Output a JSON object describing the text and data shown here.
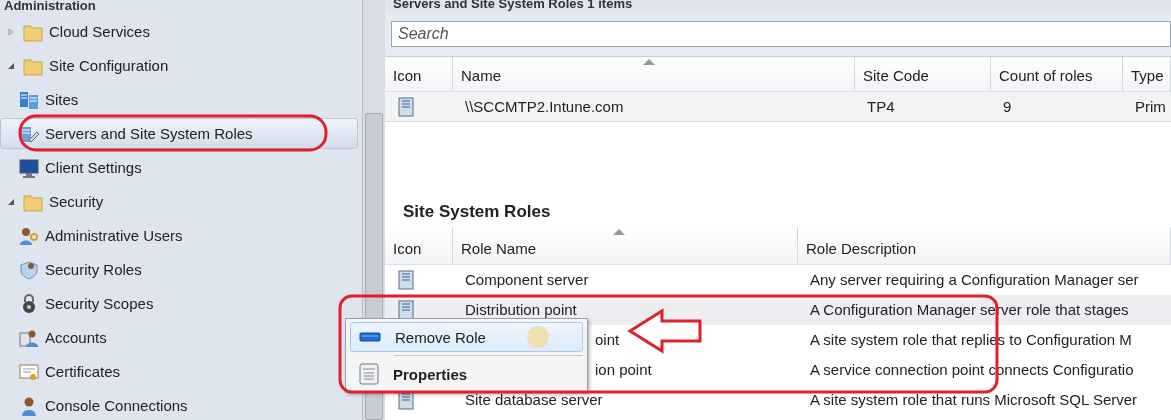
{
  "sidebar": {
    "header": "Administration",
    "items": [
      {
        "label": "Cloud Services",
        "kind": "folder",
        "expanded": false,
        "selected": false
      },
      {
        "label": "Site Configuration",
        "kind": "folder",
        "expanded": true,
        "selected": false,
        "children": [
          {
            "label": "Sites",
            "kind": "node",
            "selected": false
          },
          {
            "label": "Servers and Site System Roles",
            "kind": "node",
            "selected": true
          },
          {
            "label": "Client Settings",
            "kind": "node",
            "selected": false
          }
        ]
      },
      {
        "label": "Security",
        "kind": "folder",
        "expanded": true,
        "selected": false,
        "children": [
          {
            "label": "Administrative Users",
            "kind": "node",
            "selected": false
          },
          {
            "label": "Security Roles",
            "kind": "node",
            "selected": false
          },
          {
            "label": "Security Scopes",
            "kind": "node",
            "selected": false
          },
          {
            "label": "Accounts",
            "kind": "node",
            "selected": false
          },
          {
            "label": "Certificates",
            "kind": "node",
            "selected": false
          },
          {
            "label": "Console Connections",
            "kind": "node",
            "selected": false
          }
        ]
      }
    ]
  },
  "servers": {
    "title": "Servers and Site System Roles 1 items",
    "search": {
      "placeholder": "Search"
    },
    "columns": [
      "Icon",
      "Name",
      "Site Code",
      "Count of roles",
      "Type"
    ],
    "rows": [
      {
        "name": "\\\\SCCMTP2.Intune.com",
        "site_code": "TP4",
        "count": "9",
        "type": "Prim"
      }
    ]
  },
  "roles": {
    "title": "Site System Roles",
    "columns": [
      "Icon",
      "Role Name",
      "Role Description"
    ],
    "rows": [
      {
        "name": "Component server",
        "description": "Any server requiring a Configuration Manager ser",
        "selected": false
      },
      {
        "name": "Distribution point",
        "description": "A Configuration Manager server role that stages",
        "selected": true
      },
      {
        "name": "oint",
        "description": "A site system role that replies to Configuration M",
        "selected": false
      },
      {
        "name": "ion point",
        "description": "A service connection point connects Configuratio",
        "selected": false
      },
      {
        "name": "Site database server",
        "description": "A site system role that runs Microsoft SQL Server",
        "selected": false
      }
    ]
  },
  "context_menu": [
    {
      "label": "Remove Role",
      "selected": true,
      "default": false
    },
    {
      "label": "Properties",
      "selected": false,
      "default": true
    }
  ]
}
